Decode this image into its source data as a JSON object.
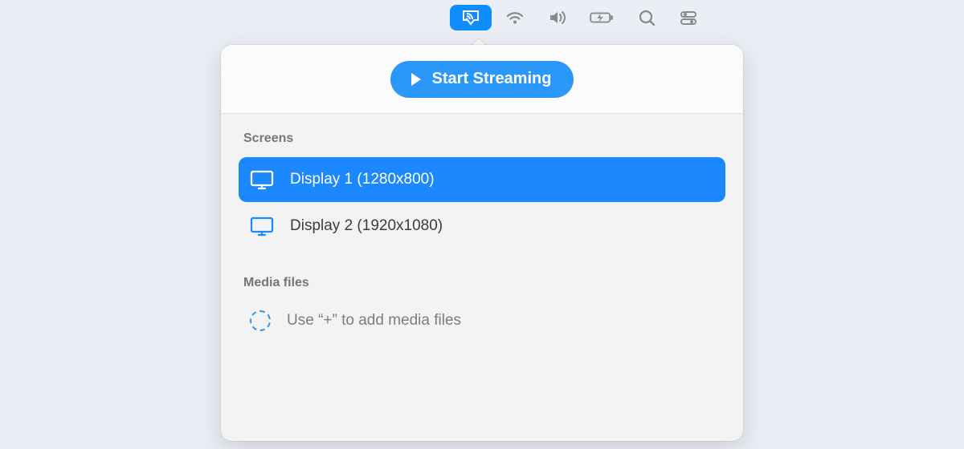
{
  "menubar": {
    "items": [
      {
        "name": "airplay-icon",
        "active": true
      },
      {
        "name": "wifi-icon",
        "active": false
      },
      {
        "name": "volume-icon",
        "active": false
      },
      {
        "name": "battery-charging-icon",
        "active": false
      },
      {
        "name": "search-icon",
        "active": false
      },
      {
        "name": "control-center-icon",
        "active": false
      }
    ]
  },
  "popover": {
    "start_button": "Start Streaming",
    "screens_heading": "Screens",
    "screens": [
      {
        "label": "Display 1 (1280x800)",
        "selected": true
      },
      {
        "label": "Display 2 (1920x1080)",
        "selected": false
      }
    ],
    "media_heading": "Media files",
    "media_placeholder": "Use “+” to add media files"
  }
}
